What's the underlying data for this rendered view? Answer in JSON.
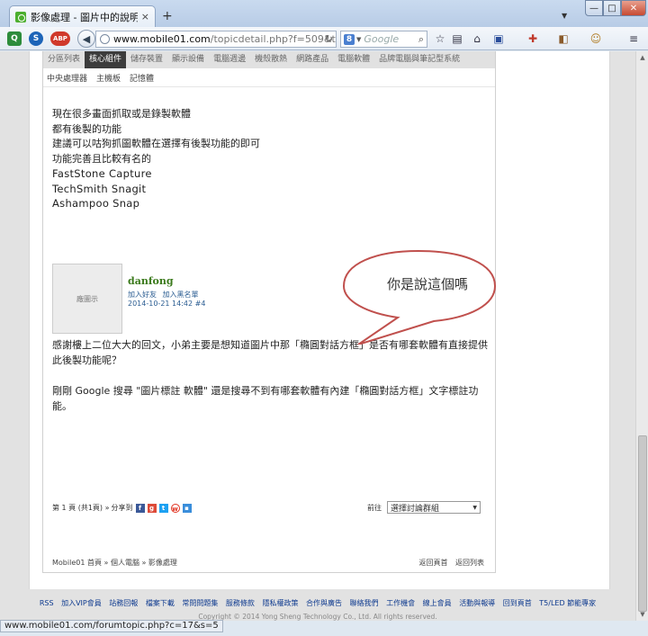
{
  "browser": {
    "tab_title": "影像處理 - 圖片中的說明解...",
    "tab_close": "×",
    "new_tab": "+",
    "url_host": "www.mobile01.com",
    "url_path": "/topicdetail.php?f=509&t=41...",
    "search_placeholder": "Google",
    "status_url": "www.mobile01.com/forumtopic.php?c=17&s=5"
  },
  "category_nav": {
    "items": [
      "分區列表",
      "核心組件",
      "儲存裝置",
      "顯示設備",
      "電腦週邊",
      "機殼散熱",
      "網路產品",
      "電腦軟體",
      "品牌電腦與筆記型系統"
    ],
    "active_index": 1
  },
  "sub_nav": {
    "items": [
      "中央處理器",
      "主機板",
      "記憶體"
    ]
  },
  "post": {
    "lines": [
      "現在很多畫面抓取或是錄製軟體",
      "都有後製的功能",
      "建議可以咕狗抓圖軟體在選擇有後製功能的即可",
      "功能完善且比較有名的"
    ],
    "software": [
      "FastStone Capture",
      "TechSmith Snagit",
      "Ashampoo Snap"
    ]
  },
  "author": {
    "avatar_label": "廠圖示",
    "name": "danfong",
    "add_friend": "加入好友",
    "add_blacklist": "加入黑名單",
    "meta": "2014-10-21 14:42 #4"
  },
  "reply": {
    "p1": "感謝樓上二位大大的回文，小弟主要是想知道圖片中那「橢圓對話方框」是否有哪套軟體有直接提供此後製功能呢？",
    "p2": "剛剛 Google 搜尋 \"圖片標註 軟體\" 還是搜尋不到有哪套軟體有內建「橢圓對話方框」文字標註功能。"
  },
  "callout": {
    "text": "你是說這個嗎"
  },
  "pager": {
    "page_text": "第 1 頁 (共1頁) »",
    "share_label": "分享到",
    "goto_label": "前往",
    "select_value": "選擇討論群組"
  },
  "breadcrumb": "Mobile01 首頁 » 個人電腦 » 影像處理",
  "back_links": [
    "返回頁首",
    "返回列表"
  ],
  "footer": {
    "links": [
      "RSS",
      "加入VIP會員",
      "站務回報",
      "檔案下載",
      "常問問題集",
      "服務條款",
      "隱私權政策",
      "合作與廣告",
      "聯絡我們",
      "工作機會",
      "線上會員",
      "活動與報導",
      "回到頁首",
      "T5/LED 節能專家"
    ],
    "copyright": "Copyright © 2014 Yong Sheng Technology Co., Ltd. All rights reserved."
  },
  "colors": {
    "accent_green": "#3b7a1c",
    "link_blue": "#2b5d92",
    "active_nav": "#3c3c3c"
  }
}
